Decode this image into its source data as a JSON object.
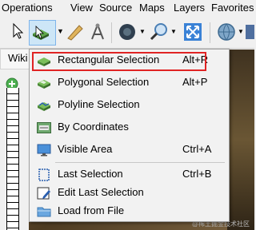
{
  "menubar": {
    "items": [
      "Operations",
      "View",
      "Source",
      "Maps",
      "Layers",
      "Favorites"
    ]
  },
  "sidebar": {
    "tab_label": "Wiki"
  },
  "dropdown": {
    "items": [
      {
        "label": "Rectangular Selection",
        "shortcut": "Alt+R",
        "icon": "rectangle-selection-icon",
        "highlighted": true
      },
      {
        "label": "Polygonal Selection",
        "shortcut": "Alt+P",
        "icon": "polygon-selection-icon"
      },
      {
        "label": "Polyline Selection",
        "shortcut": "",
        "icon": "polyline-selection-icon"
      },
      {
        "label": "By Coordinates",
        "shortcut": "",
        "icon": "coordinates-icon"
      },
      {
        "label": "Visible Area",
        "shortcut": "Ctrl+A",
        "icon": "monitor-icon"
      },
      {
        "label": "Last Selection",
        "shortcut": "Ctrl+B",
        "icon": "last-selection-icon"
      },
      {
        "label": "Edit Last Selection",
        "shortcut": "",
        "icon": "edit-selection-icon"
      },
      {
        "label": "Load from File",
        "shortcut": "",
        "icon": "folder-icon"
      }
    ]
  },
  "watermark": "@稀土掘金技术社区",
  "colors": {
    "highlight_border": "#e02424",
    "menu_bg": "#f2f2f2",
    "toolbar_bg": "#f0f0f0"
  }
}
